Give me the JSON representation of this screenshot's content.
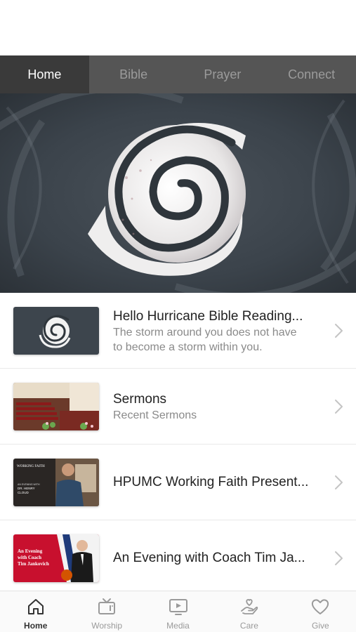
{
  "status_bar": {
    "time": ""
  },
  "tabs": [
    {
      "label": "Home",
      "active": true
    },
    {
      "label": "Bible",
      "active": false
    },
    {
      "label": "Prayer",
      "active": false
    },
    {
      "label": "Connect",
      "active": false
    }
  ],
  "list": [
    {
      "title": "Hello Hurricane Bible Reading...",
      "subtitle": "The storm around you does not have",
      "subtitle2": "to become a storm within you."
    },
    {
      "title": "Sermons",
      "subtitle": "Recent Sermons"
    },
    {
      "title": "HPUMC Working Faith Present...",
      "thumb_text": [
        "WORKING FAITH",
        "AN EVENING WITH",
        "DR. HENRY",
        "CLOUD"
      ]
    },
    {
      "title": "An Evening with Coach Tim Ja...",
      "thumb_text": [
        "An Evening",
        "with Coach",
        "Tim Jankovich"
      ]
    }
  ],
  "bottom_nav": [
    {
      "label": "Home",
      "icon": "home-icon",
      "active": true
    },
    {
      "label": "Worship",
      "icon": "tv-icon",
      "active": false
    },
    {
      "label": "Media",
      "icon": "play-screen-icon",
      "active": false
    },
    {
      "label": "Care",
      "icon": "hand-heart-icon",
      "active": false
    },
    {
      "label": "Give",
      "icon": "heart-icon",
      "active": false
    }
  ],
  "colors": {
    "tab_bar": "#555555",
    "tab_active": "#3a3a3a",
    "brand_red": "#c8102e"
  }
}
